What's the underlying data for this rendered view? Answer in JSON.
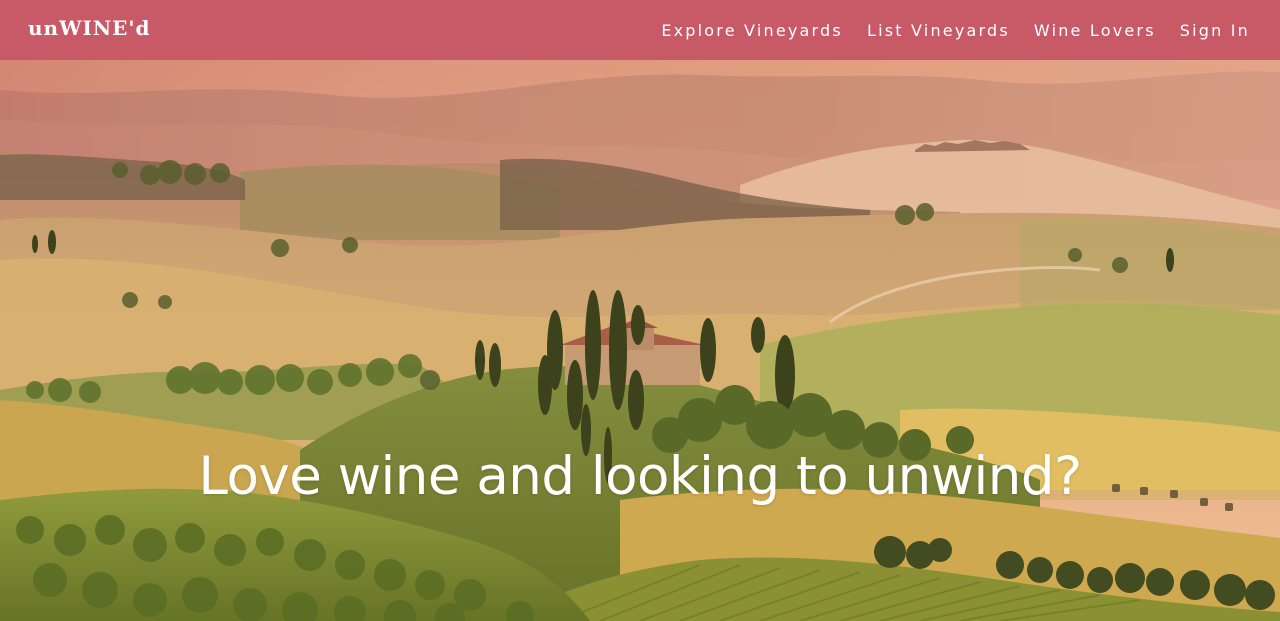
{
  "navbar": {
    "brand": "unWINE'd",
    "links": [
      {
        "label": "Explore Vineyards"
      },
      {
        "label": "List Vineyards"
      },
      {
        "label": "Wine Lovers"
      },
      {
        "label": "Sign In"
      }
    ],
    "background_color": "#c85a68"
  },
  "hero": {
    "headline": "Love wine and looking to unwind?"
  }
}
